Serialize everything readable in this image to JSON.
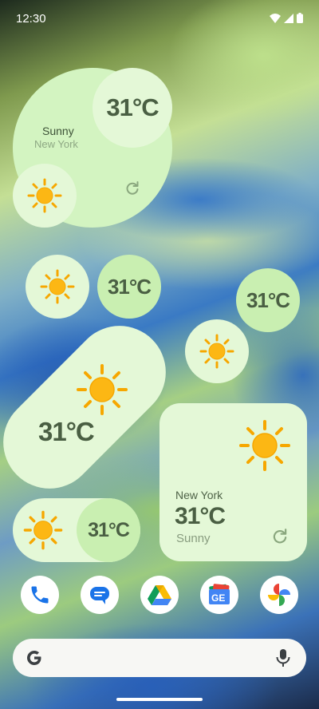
{
  "status_bar": {
    "time": "12:30"
  },
  "widgets": {
    "large_circle": {
      "temperature": "31°C",
      "condition": "Sunny",
      "city": "New York"
    },
    "small_pair": {
      "temperature": "31°C"
    },
    "right_pair": {
      "temperature": "31°C"
    },
    "diagonal_pill": {
      "temperature": "31°C"
    },
    "card": {
      "city": "New York",
      "temperature": "31°C",
      "condition": "Sunny"
    },
    "horizontal_pill": {
      "temperature": "31°C"
    }
  },
  "dock": {
    "apps": [
      "phone-icon",
      "messages-icon",
      "drive-icon",
      "news-icon",
      "photos-icon"
    ]
  },
  "search_bar": {
    "logo": "google-g-icon",
    "mic": "microphone-icon"
  },
  "colors": {
    "widget_light": "#e4f8d7",
    "widget_mid": "#c9efb1",
    "sun": "#fcb714",
    "text_dark": "#4a5f43"
  }
}
